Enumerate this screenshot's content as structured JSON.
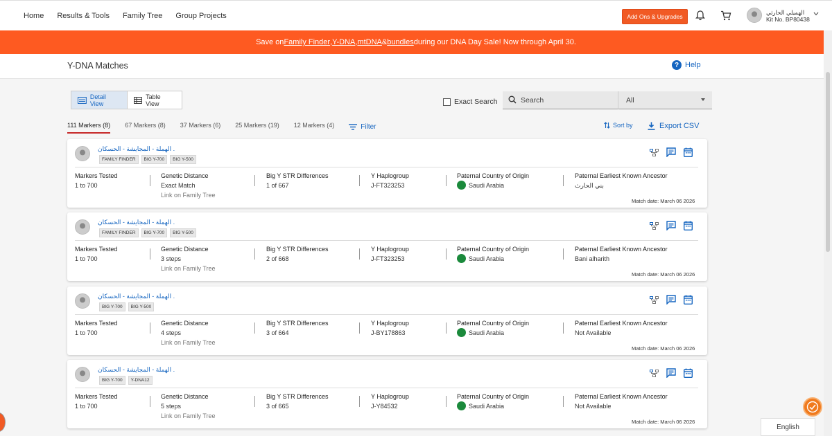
{
  "nav": {
    "home": "Home",
    "results": "Results & Tools",
    "family_tree": "Family Tree",
    "group_projects": "Group Projects"
  },
  "header": {
    "addons": "Add Ons & Upgrades",
    "user_name": "الهميلي الحارثي",
    "kit": "Kit No. BP80438"
  },
  "banner": {
    "prefix": "Save on ",
    "ff": "Family Finder",
    "comma1": ", ",
    "ydna": "Y-DNA",
    "comma2": ", ",
    "mtdna": "mtDNA",
    "amp": " & ",
    "bundles": "bundles",
    "suffix": " during our DNA Day Sale! Now through April 30."
  },
  "page": {
    "title": "Y-DNA Matches",
    "help": "Help"
  },
  "views": {
    "detail": "Detail View",
    "table": "Table View"
  },
  "search": {
    "exact": "Exact Search",
    "placeholder": "Search",
    "filter_value": "All"
  },
  "tabs": [
    "111 Markers (8)",
    "67 Markers (8)",
    "37 Markers (6)",
    "25 Markers (19)",
    "12 Markers (4)"
  ],
  "toolbar": {
    "filter": "Filter",
    "sortby": "Sort by",
    "export": "Export CSV"
  },
  "columns": {
    "markers": "Markers Tested",
    "distance": "Genetic Distance",
    "str": "Big Y STR Differences",
    "haplo": "Y Haplogroup",
    "country": "Paternal Country of Origin",
    "ancestor": "Paternal Earliest Known Ancestor"
  },
  "link_text": "Link on Family Tree",
  "matches": [
    {
      "name": "الهملة - المجايشة - الحسكان .",
      "badges": [
        "FAMILY FINDER",
        "BIG Y-700",
        "BIG Y-500"
      ],
      "markers": "1 to 700",
      "distance": "Exact Match",
      "str": "1 of 667",
      "haplo": "J-FT323253",
      "country": "Saudi Arabia",
      "ancestor": "بني الحارث",
      "date": "Match date: March 06 2026"
    },
    {
      "name": "الهملة - المجايشة - الحسكان .",
      "badges": [
        "FAMILY FINDER",
        "BIG Y-700",
        "BIG Y-500"
      ],
      "markers": "1 to 700",
      "distance": "3 steps",
      "str": "2 of 668",
      "haplo": "J-FT323253",
      "country": "Saudi Arabia",
      "ancestor": "Bani alharith",
      "date": "Match date: March 06 2026"
    },
    {
      "name": "الهملة - المجايشة - الحسكان .",
      "badges": [
        "BIG Y-700",
        "BIG Y-500"
      ],
      "markers": "1 to 700",
      "distance": "4 steps",
      "str": "3 of 664",
      "haplo": "J-BY178863",
      "country": "Saudi Arabia",
      "ancestor": "Not Available",
      "date": "Match date: March 06 2026"
    },
    {
      "name": "الهملة - المجايشة - الحسكان .",
      "badges": [
        "BIG Y-700",
        "Y-DNA12"
      ],
      "markers": "1 to 700",
      "distance": "5 steps",
      "str": "3 of 665",
      "haplo": "J-Y84532",
      "country": "Saudi Arabia",
      "ancestor": "Not Available",
      "date": "Match date: March 06 2026"
    }
  ],
  "language": "English",
  "colors": {
    "accent": "#fe5a21",
    "link": "#1565c0",
    "flag": "#1b8a3c"
  }
}
